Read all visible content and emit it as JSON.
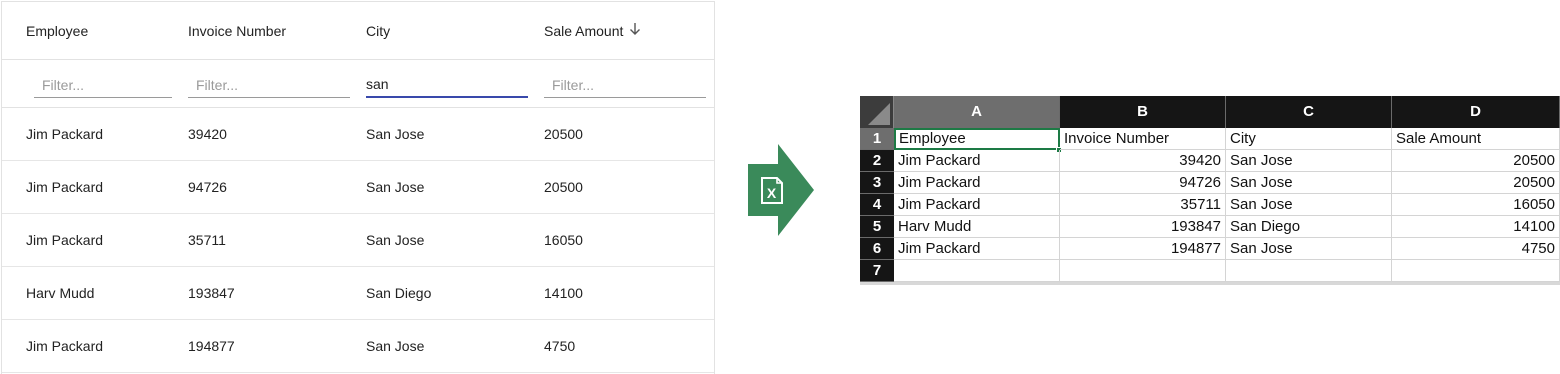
{
  "grid": {
    "columns": [
      {
        "label": "Employee"
      },
      {
        "label": "Invoice Number"
      },
      {
        "label": "City"
      },
      {
        "label": "Sale Amount",
        "sort": "descending"
      }
    ],
    "filters": [
      {
        "placeholder": "Filter...",
        "value": ""
      },
      {
        "placeholder": "Filter...",
        "value": ""
      },
      {
        "placeholder": "Filter...",
        "value": "san"
      },
      {
        "placeholder": "Filter...",
        "value": ""
      }
    ],
    "rows": [
      [
        "Jim Packard",
        "39420",
        "San Jose",
        "20500"
      ],
      [
        "Jim Packard",
        "94726",
        "San Jose",
        "20500"
      ],
      [
        "Jim Packard",
        "35711",
        "San Jose",
        "16050"
      ],
      [
        "Harv Mudd",
        "193847",
        "San Diego",
        "14100"
      ],
      [
        "Jim Packard",
        "194877",
        "San Jose",
        "4750"
      ]
    ]
  },
  "arrow": {
    "icon": "excel-export-icon",
    "label": "X",
    "color": "#3a8a5a"
  },
  "spreadsheet": {
    "column_letters": [
      "A",
      "B",
      "C",
      "D"
    ],
    "row_numbers": [
      "1",
      "2",
      "3",
      "4",
      "5",
      "6",
      "7"
    ],
    "header": [
      "Employee",
      "Invoice Number",
      "City",
      "Sale Amount"
    ],
    "rows": [
      [
        "Jim Packard",
        "39420",
        "San Jose",
        "20500"
      ],
      [
        "Jim Packard",
        "94726",
        "San Jose",
        "20500"
      ],
      [
        "Jim Packard",
        "35711",
        "San Jose",
        "16050"
      ],
      [
        "Harv Mudd",
        "193847",
        "San Diego",
        "14100"
      ],
      [
        "Jim Packard",
        "194877",
        "San Jose",
        "4750"
      ]
    ],
    "selected_cell": "A1",
    "selection_color": "#1d7a45"
  }
}
